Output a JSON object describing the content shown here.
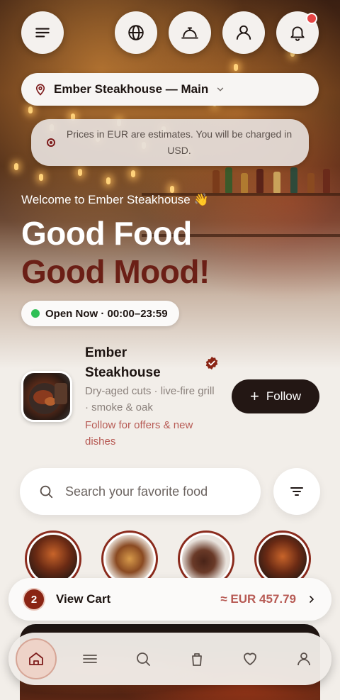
{
  "header": {
    "location_name": "Ember Steakhouse — Main",
    "notice": "Prices in EUR are estimates. You will be charged in USD."
  },
  "icons": {
    "menu": "menu-icon",
    "language": "globe-icon",
    "service": "service-bell-icon",
    "account": "user-icon",
    "notifications": "bell-icon",
    "location": "location-pin-icon",
    "dropdown": "chevron-down-icon"
  },
  "hero": {
    "welcome": "Welcome to Ember Steakhouse 👋",
    "headline_line1": "Good Food",
    "headline_line2": "Good Mood!",
    "hours": "Open Now · 00:00–23:59"
  },
  "restaurant": {
    "name": "Ember Steakhouse",
    "description": "Dry-aged cuts · live-fire grill · smoke & oak",
    "offer_text": "Follow for offers & new dishes",
    "follow_label": "Follow"
  },
  "search": {
    "placeholder": "Search your favorite food"
  },
  "cart": {
    "count": "2",
    "label": "View Cart",
    "total": "≈ EUR 457.79"
  },
  "bottom_nav": [
    "home",
    "menu",
    "search",
    "orders",
    "favorites",
    "profile"
  ],
  "colors": {
    "brand_dark": "#231714",
    "accent_red": "#6b1f16",
    "offer_text": "#b75a54",
    "open_green": "#2fbf55",
    "notification": "#e64545"
  }
}
